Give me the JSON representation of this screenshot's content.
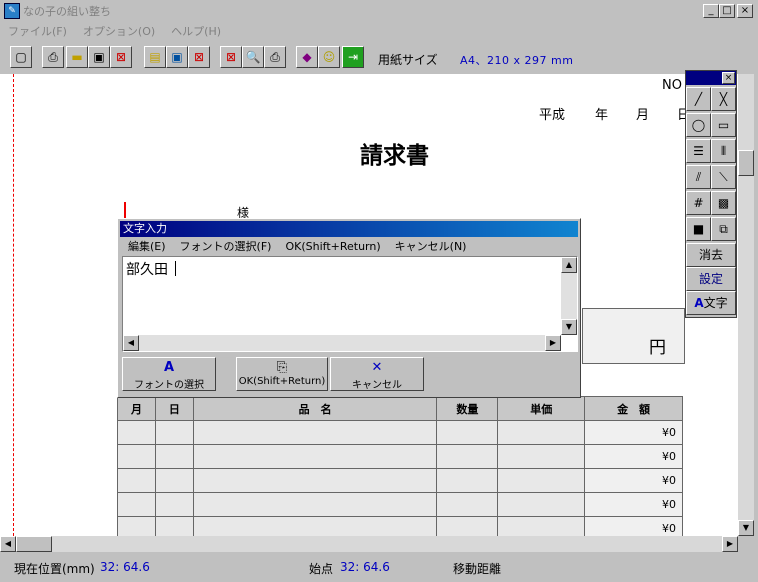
{
  "window": {
    "title": "なの子の組い整ち",
    "controls": {
      "minimize": "_",
      "maximize": "□",
      "close": "×"
    }
  },
  "menu": [
    "ファイル(F)",
    "オプション(O)",
    "ヘルプ(H)"
  ],
  "toolbar": {
    "paper_size_label": "用紙サイズ",
    "paper_size_value": "A4、210 x 297 mm"
  },
  "document": {
    "no_label": "NO",
    "date_era": "平成",
    "date_year": "年",
    "date_month": "月",
    "date_day": "日",
    "title": "請求書",
    "addressee_suffix": "様",
    "amount_unit": "円",
    "table": {
      "headers": [
        "月",
        "日",
        "品　名",
        "数量",
        "単価",
        "金　額"
      ],
      "rows": [
        {
          "price": "¥0"
        },
        {
          "price": "¥0"
        },
        {
          "price": "¥0"
        },
        {
          "price": "¥0"
        },
        {
          "price": "¥0"
        }
      ]
    }
  },
  "palette": {
    "close": "×",
    "erase": "消去",
    "settings": "設定",
    "text": "文字"
  },
  "dialog": {
    "title": "文字入力",
    "menu": [
      "編集(E)",
      "フォントの選択(F)",
      "OK(Shift+Return)",
      "キャンセル(N)"
    ],
    "text_value": "部久田",
    "buttons": {
      "font": "フォントの選択",
      "ok": "OK(Shift+Return)",
      "cancel": "キャンセル"
    }
  },
  "status": {
    "position_label": "現在位置(mm)",
    "position_value": "32:  64.6",
    "start_label": "始点",
    "start_value": "32:  64.6",
    "move_label": "移動距離"
  },
  "colors": {
    "accent": "#000080",
    "status_value": "#0000c0"
  }
}
